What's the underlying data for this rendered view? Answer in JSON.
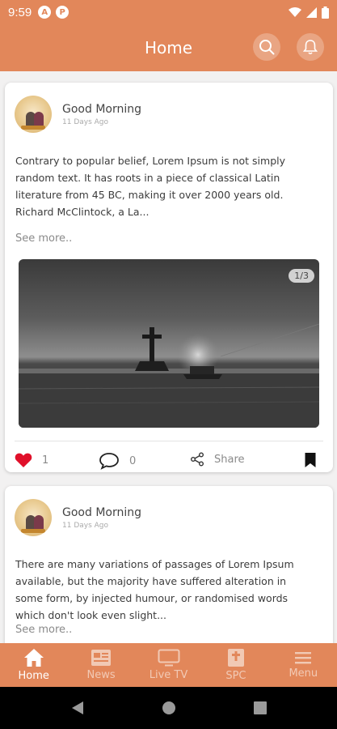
{
  "status_bar": {
    "time": "9:59",
    "icon_a": "A",
    "icon_b": "P",
    "right_icons": [
      "wifi-icon",
      "signal-icon",
      "battery-icon"
    ]
  },
  "header": {
    "title": "Home",
    "accent_color": "#e2875a"
  },
  "posts": [
    {
      "author": "Good Morning",
      "time": "11 Days Ago",
      "text": "Contrary to popular belief, Lorem Ipsum is not simply random text. It has roots in a piece of classical Latin literature from 45 BC, making it over 2000 years old. Richard McClintock, a La...",
      "see_more": "See more..",
      "image_counter": "1/3",
      "likes": "1",
      "comments": "0",
      "share_label": "Share"
    },
    {
      "author": "Good Morning",
      "time": "11 Days Ago",
      "text": "There are many variations of passages of Lorem Ipsum available, but the majority have suffered alteration in some form, by injected humour, or randomised words which don't look even slight...",
      "see_more": "See more.."
    }
  ],
  "bottom_nav": [
    {
      "label": "Home",
      "icon": "home-icon",
      "active": true
    },
    {
      "label": "News",
      "icon": "news-icon",
      "active": false
    },
    {
      "label": "Live TV",
      "icon": "tv-icon",
      "active": false
    },
    {
      "label": "SPC",
      "icon": "book-icon",
      "active": false
    },
    {
      "label": "Menu",
      "icon": "menu-icon",
      "active": false
    }
  ],
  "colors": {
    "like": "#e0102a",
    "accent": "#e2875a"
  }
}
